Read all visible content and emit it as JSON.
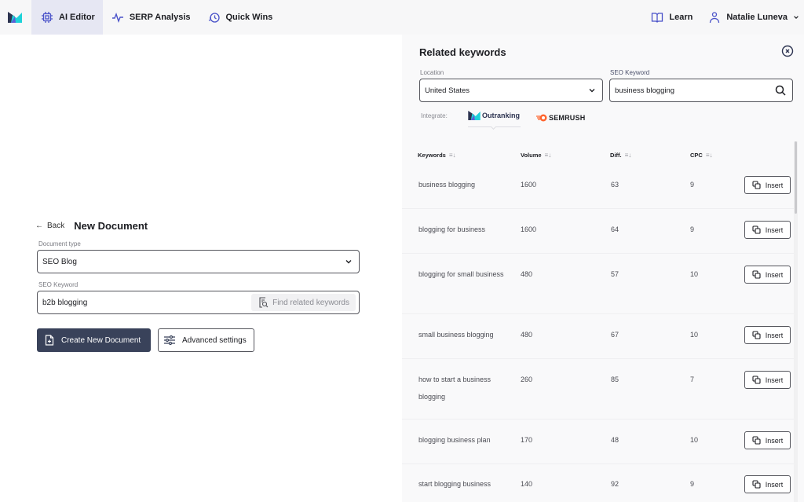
{
  "nav": {
    "logo": "outranking-logo",
    "items": [
      {
        "label": "AI Editor",
        "icon": "chip-icon",
        "active": true
      },
      {
        "label": "SERP Analysis",
        "icon": "pulse-icon",
        "active": false
      },
      {
        "label": "Quick Wins",
        "icon": "quick-wins-icon",
        "active": false
      }
    ],
    "learn_label": "Learn",
    "user_name": "Natalie Luneva"
  },
  "doc": {
    "back_label": "Back",
    "title": "New Document",
    "doc_type_label": "Document type",
    "doc_type_value": "SEO Blog",
    "seo_keyword_label": "SEO Keyword",
    "seo_keyword_value": "b2b blogging",
    "find_related_label": "Find related keywords",
    "create_label": "Create New Document",
    "advanced_label": "Advanced settings"
  },
  "related": {
    "title": "Related keywords",
    "location_label": "Location",
    "location_value": "United States",
    "keyword_label": "SEO Keyword",
    "keyword_value": "business blogging",
    "integrate_label": "Integrate:",
    "integrations": [
      "Outranking",
      "SEMRUSH"
    ],
    "columns": [
      "Keywords",
      "Volume",
      "Diff.",
      "CPC"
    ],
    "insert_label": "Insert",
    "rows": [
      {
        "keyword": "business blogging",
        "volume": "1600",
        "diff": "63",
        "cpc": "9"
      },
      {
        "keyword": "blogging for business",
        "volume": "1600",
        "diff": "64",
        "cpc": "9"
      },
      {
        "keyword": "blogging for small business",
        "volume": "480",
        "diff": "57",
        "cpc": "10"
      },
      {
        "keyword": "small business blogging",
        "volume": "480",
        "diff": "67",
        "cpc": "10"
      },
      {
        "keyword": "how to start a business blogging",
        "volume": "260",
        "diff": "85",
        "cpc": "7"
      },
      {
        "keyword": "blogging business plan",
        "volume": "170",
        "diff": "48",
        "cpc": "10"
      },
      {
        "keyword": "start blogging business",
        "volume": "140",
        "diff": "92",
        "cpc": "9"
      }
    ]
  },
  "colors": {
    "accent": "#4a52c9",
    "primary_button": "#39425a",
    "nav_active_bg": "#e6e7f3",
    "semrush_orange": "#ff642d",
    "outranking_teal": "#1ed3d9"
  }
}
